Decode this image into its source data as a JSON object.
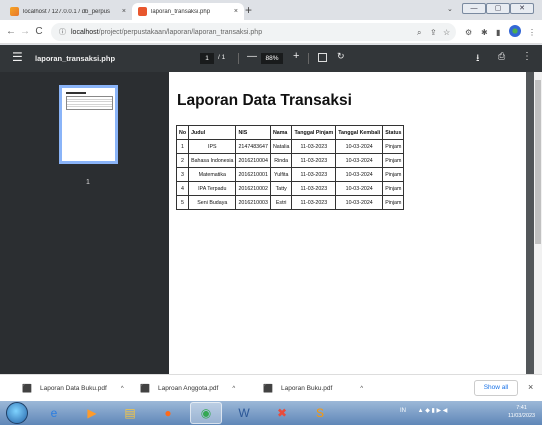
{
  "browser": {
    "tabs": [
      {
        "title": "localhost / 127.0.0.1 / db_perpus",
        "favicon": "phpmyadmin-icon"
      },
      {
        "title": "laporan_transaksi.php",
        "favicon": "pdf-tab-icon"
      }
    ],
    "close_glyph": "×",
    "new_tab_glyph": "+",
    "url_host": "localhost",
    "url_path": "/project/perpustakaan/laporan/laporan_transaksi.php",
    "window_buttons": [
      "—",
      "▢",
      "✕"
    ]
  },
  "pdf_viewer": {
    "file_title": "laporan_transaksi.php",
    "current_page": "1",
    "total_pages": "/ 1",
    "zoom": "88%",
    "zoom_out": "—",
    "zoom_in": "+",
    "thumbnail_page": "1"
  },
  "report": {
    "title": "Laporan Data Transaksi",
    "headers": [
      "No",
      "Judul",
      "NIS",
      "Nama",
      "Tanggal Pinjam",
      "Tanggal Kembali",
      "Status"
    ],
    "rows": [
      [
        "1",
        "IPS",
        "2147483647",
        "Natalia",
        "11-03-2023",
        "10-03-2024",
        "Pinjam"
      ],
      [
        "2",
        "Bahasa Indonesia",
        "2016210004",
        "Rinda",
        "11-03-2023",
        "10-03-2024",
        "Pinjam"
      ],
      [
        "3",
        "Matematika",
        "2016210001",
        "Yulfita",
        "11-03-2023",
        "10-03-2024",
        "Pinjam"
      ],
      [
        "4",
        "IPA Terpadu",
        "2016210002",
        "Tatty",
        "11-03-2023",
        "10-03-2024",
        "Pinjam"
      ],
      [
        "5",
        "Seni Budaya",
        "2016210003",
        "Estri",
        "11-03-2023",
        "10-03-2024",
        "Pinjam"
      ]
    ]
  },
  "downloads": {
    "items": [
      "Laporan Data Buku.pdf",
      "Laproan Anggota.pdf",
      "Laporan Buku.pdf"
    ],
    "show_all": "Show all",
    "close": "×"
  },
  "taskbar": {
    "tray_lang": "IN",
    "time": "7:41",
    "date": "11/03/2023"
  }
}
